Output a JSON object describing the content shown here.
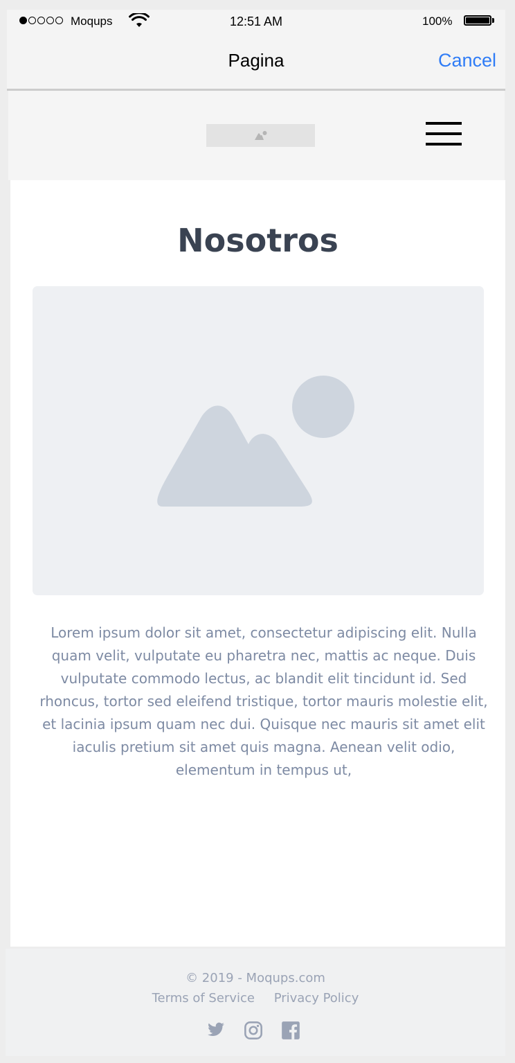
{
  "status_bar": {
    "carrier": "Moqups",
    "time": "12:51 AM",
    "battery": "100%",
    "signal_strength": 1,
    "signal_max": 5
  },
  "nav": {
    "title": "Pagina",
    "cancel_label": "Cancel"
  },
  "header": {
    "logo_icon": "image-placeholder-icon",
    "menu_icon": "hamburger-menu-icon"
  },
  "main": {
    "title": "Nosotros",
    "image_icon": "image-placeholder-icon",
    "body": "Lorem ipsum dolor sit amet, consectetur adipiscing elit. Nulla quam velit, vulputate eu pharetra nec, mattis ac neque. Duis vulputate commodo lectus, ac blandit elit tincidunt id. Sed rhoncus, tortor sed eleifend tristique, tortor mauris molestie elit, et lacinia ipsum quam nec dui. Quisque nec mauris sit amet elit iaculis pretium sit amet quis magna. Aenean velit odio, elementum in tempus ut,"
  },
  "footer": {
    "copyright": "© 2019 - Moqups.com",
    "links": [
      "Terms of Service",
      "Privacy Policy"
    ],
    "social_icons": [
      "twitter-icon",
      "instagram-icon",
      "facebook-icon"
    ]
  },
  "colors": {
    "accent": "#2f7cf6",
    "title": "#3a4352",
    "body_text": "#7d8aa3",
    "footer_text": "#9aa3b5",
    "placeholder": "#ced5de"
  }
}
